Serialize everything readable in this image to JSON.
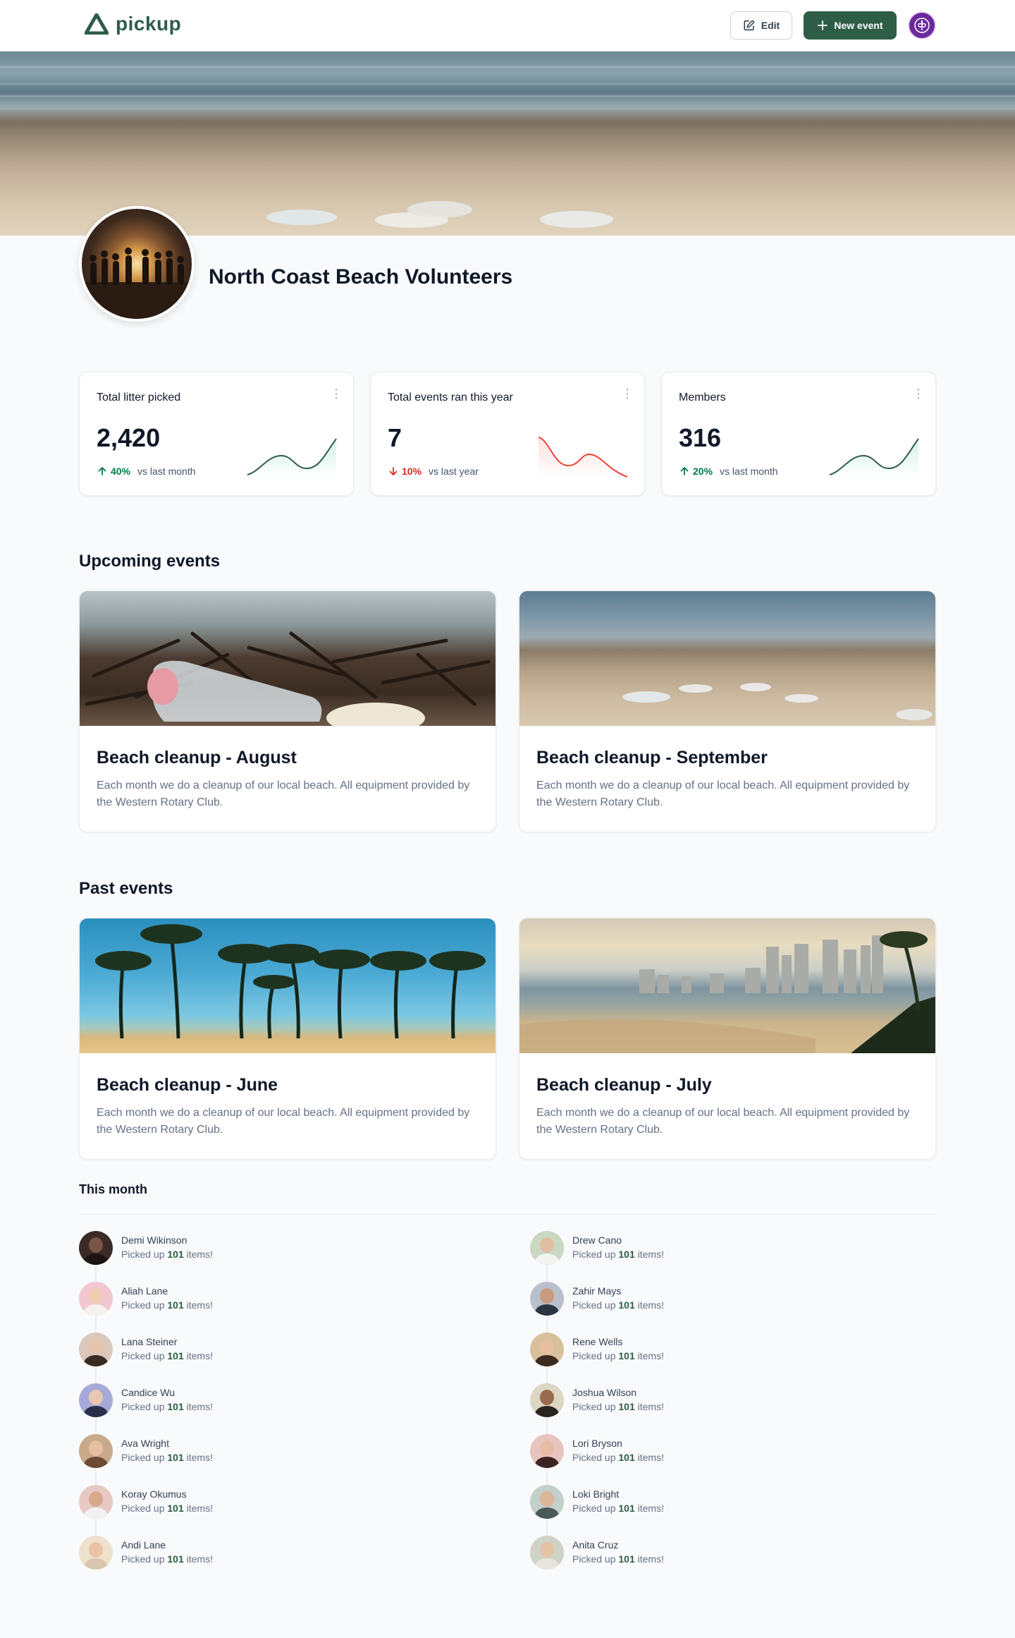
{
  "app": {
    "name": "pickup"
  },
  "header": {
    "edit_label": "Edit",
    "new_event_label": "New event"
  },
  "group": {
    "name": "North Coast Beach Volunteers"
  },
  "stats": [
    {
      "title": "Total litter picked",
      "value": "2,420",
      "trend_direction": "up",
      "trend_pct": "40%",
      "trend_label": "vs last month",
      "color": "#12b76a"
    },
    {
      "title": "Total events ran this year",
      "value": "7",
      "trend_direction": "down",
      "trend_pct": "10%",
      "trend_label": "vs last year",
      "color": "#f04438"
    },
    {
      "title": "Members",
      "value": "316",
      "trend_direction": "up",
      "trend_pct": "20%",
      "trend_label": "vs last month",
      "color": "#12b76a"
    }
  ],
  "upcoming": {
    "heading": "Upcoming events",
    "events": [
      {
        "title": "Beach cleanup - August",
        "description": "Each month we do a cleanup of our local beach. All equipment provided by the Western Rotary Club."
      },
      {
        "title": "Beach cleanup - September",
        "description": "Each month we do a cleanup of our local beach. All equipment provided by the Western Rotary Club."
      }
    ]
  },
  "past": {
    "heading": "Past events",
    "events": [
      {
        "title": "Beach cleanup - June",
        "description": "Each month we do a cleanup of our local beach. All equipment provided by the Western Rotary Club."
      },
      {
        "title": "Beach cleanup - July",
        "description": "Each month we do a cleanup of our local beach. All equipment provided by the Western Rotary Club."
      }
    ]
  },
  "this_month": {
    "heading": "This month",
    "status_prefix": "Picked up ",
    "status_suffix": " items!",
    "left": [
      {
        "name": "Demi Wikinson",
        "count": "101"
      },
      {
        "name": "Aliah Lane",
        "count": "101"
      },
      {
        "name": "Lana Steiner",
        "count": "101"
      },
      {
        "name": "Candice Wu",
        "count": "101"
      },
      {
        "name": "Ava Wright",
        "count": "101"
      },
      {
        "name": "Koray Okumus",
        "count": "101"
      },
      {
        "name": "Andi Lane",
        "count": "101"
      }
    ],
    "right": [
      {
        "name": "Drew Cano",
        "count": "101"
      },
      {
        "name": "Zahir Mays",
        "count": "101"
      },
      {
        "name": "Rene Wells",
        "count": "101"
      },
      {
        "name": "Joshua Wilson",
        "count": "101"
      },
      {
        "name": "Lori Bryson",
        "count": "101"
      },
      {
        "name": "Loki Bright",
        "count": "101"
      },
      {
        "name": "Anita Cruz",
        "count": "101"
      }
    ]
  },
  "colors": {
    "brand": "#2e5d47",
    "org_avatar": "#6b2a9b",
    "trend_up": "#027a48",
    "trend_down": "#d92d20"
  }
}
